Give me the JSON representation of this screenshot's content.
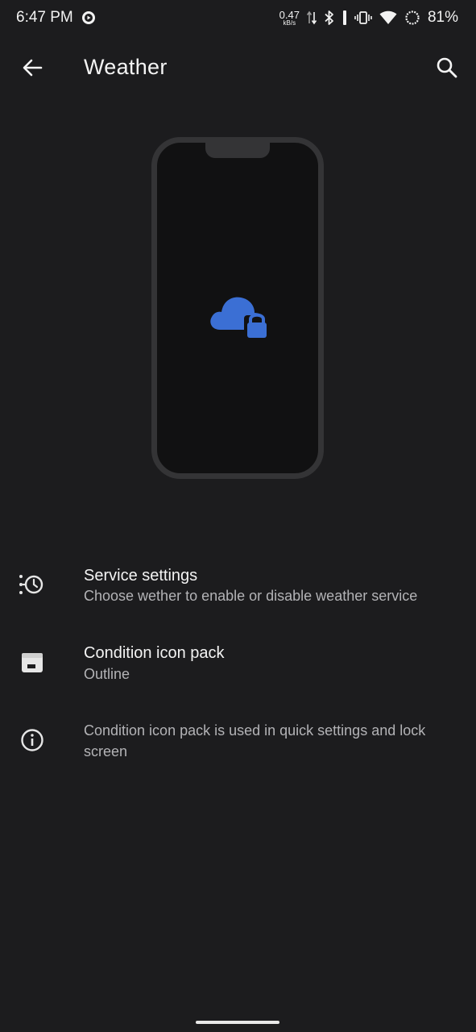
{
  "status_bar": {
    "time": "6:47 PM",
    "net_speed_value": "0.47",
    "net_speed_unit": "kB/s",
    "battery_percent": "81%",
    "icons": [
      "media-icon",
      "data-arrows-icon",
      "bluetooth-icon",
      "vibrate-icon",
      "wifi-icon",
      "battery-icon"
    ]
  },
  "app_bar": {
    "title": "Weather",
    "back_icon": "arrow-back-icon",
    "search_icon": "search-icon"
  },
  "illustration": {
    "icon": "cloud-lock-icon",
    "accent_color": "#3b6fd4"
  },
  "preferences": [
    {
      "title": "Service settings",
      "summary": "Choose wether to enable or disable weather service",
      "icon": "history-toggle-icon"
    },
    {
      "title": "Condition icon pack",
      "summary": "Outline",
      "icon": "icon-pack-icon"
    }
  ],
  "info": {
    "text": "Condition icon pack is used in quick settings and lock screen",
    "icon": "info-icon"
  },
  "colors": {
    "background": "#1c1c1e",
    "text_primary": "#f4f4f4",
    "text_secondary": "#b3b3b6",
    "accent": "#3b6fd4"
  }
}
